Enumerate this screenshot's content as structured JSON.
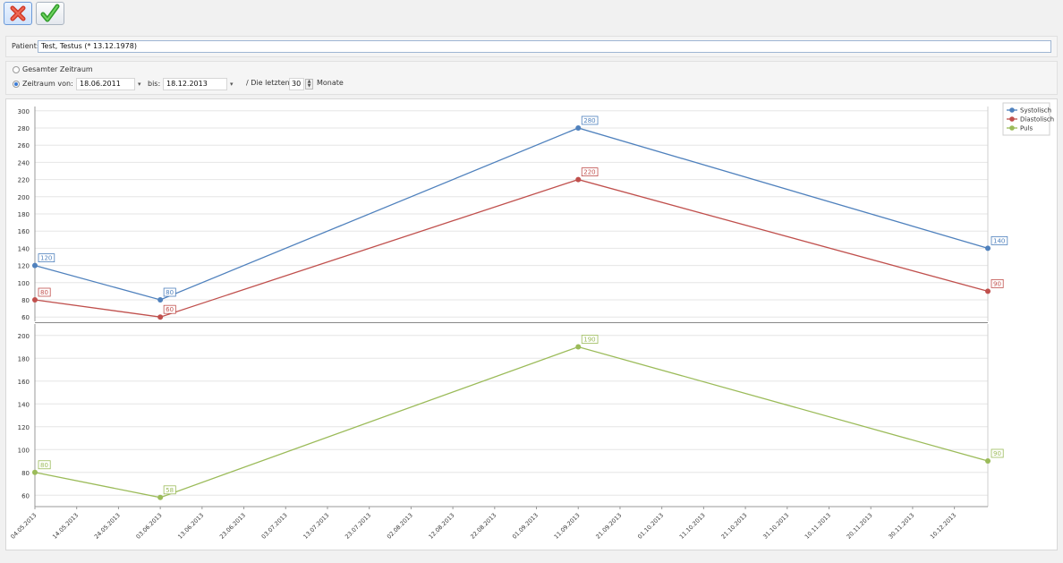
{
  "toolbar": {
    "cancel_icon": "cancel-x-icon",
    "ok_icon": "checkmark-icon"
  },
  "patient": {
    "label": "Patient:",
    "value": "Test, Testus (* 13.12.1978)"
  },
  "range": {
    "all_label": "Gesamter Zeitraum",
    "period_label": "Zeitraum von:",
    "from": "18.06.2011",
    "to_label": "bis:",
    "to": "18.12.2013",
    "last_label": "/ Die letzten",
    "months_value": "30",
    "months_label": "Monate",
    "selected": "period"
  },
  "chart_data": {
    "type": "line",
    "x_dates": [
      "04.05.2013",
      "03.06.2013",
      "11.09.2013",
      "18.12.2013"
    ],
    "x_ticks": [
      "04.05.2013",
      "14.05.2013",
      "24.05.2013",
      "03.06.2013",
      "13.06.2013",
      "23.06.2013",
      "03.07.2013",
      "13.07.2013",
      "23.07.2013",
      "02.08.2013",
      "12.08.2013",
      "22.08.2013",
      "01.09.2013",
      "11.09.2013",
      "21.09.2013",
      "01.10.2013",
      "11.10.2013",
      "21.10.2013",
      "31.10.2013",
      "10.11.2013",
      "20.11.2013",
      "30.11.2013",
      "10.12.2013"
    ],
    "grid": true,
    "legend": {
      "placement": "top-right",
      "entries": [
        "Systolisch",
        "Diastolisch",
        "Puls"
      ]
    },
    "panes": [
      {
        "ylim": [
          55,
          305
        ],
        "yticks": [
          60,
          80,
          100,
          120,
          140,
          160,
          180,
          200,
          220,
          240,
          260,
          280,
          300
        ],
        "series": [
          {
            "name": "Systolisch",
            "color": "#4f81bd",
            "values": [
              120,
              80,
              280,
              140
            ]
          },
          {
            "name": "Diastolisch",
            "color": "#c0504d",
            "values": [
              80,
              60,
              220,
              90
            ]
          }
        ]
      },
      {
        "ylim": [
          50,
          210
        ],
        "yticks": [
          60,
          80,
          100,
          120,
          140,
          160,
          180,
          200
        ],
        "series": [
          {
            "name": "Puls",
            "color": "#9bbb59",
            "values": [
              80,
              58,
              190,
              90
            ]
          }
        ]
      }
    ]
  }
}
